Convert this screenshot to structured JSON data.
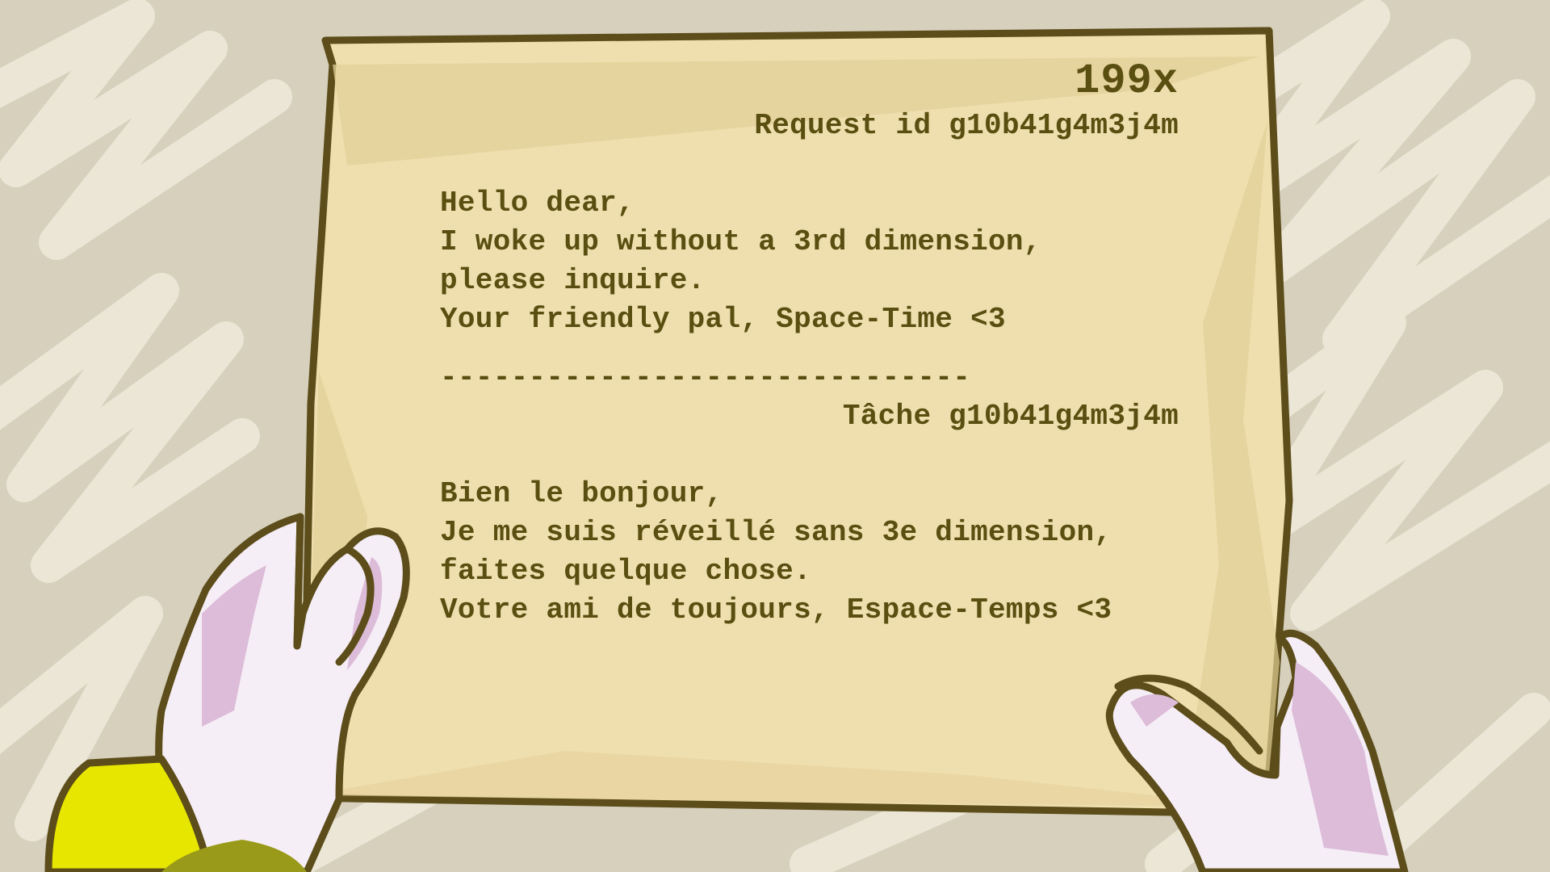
{
  "letter": {
    "count": "199x",
    "request_id": "Request id g10b41g4m3j4m",
    "english": {
      "greeting": "Hello dear,",
      "line1": "I woke up without a 3rd dimension,",
      "line2": "please inquire.",
      "signoff": "Your friendly pal, Space-Time <3"
    },
    "divider": "------------------------------",
    "task_id": "Tâche g10b41g4m3j4m",
    "french": {
      "greeting": "Bien le bonjour,",
      "line1": "Je me suis réveillé sans 3e dimension,",
      "line2": "faites quelque chose.",
      "signoff": "Votre ami de toujours, Espace-Temps <3"
    }
  },
  "colors": {
    "background": "#d6d0bd",
    "paper": "#efdfaf",
    "ink_outline": "#5c4d1a",
    "text": "#5a4e10",
    "hand": "#f6eef6",
    "hand_shadow": "#dcbcd9",
    "sleeve": "#e6e600"
  }
}
